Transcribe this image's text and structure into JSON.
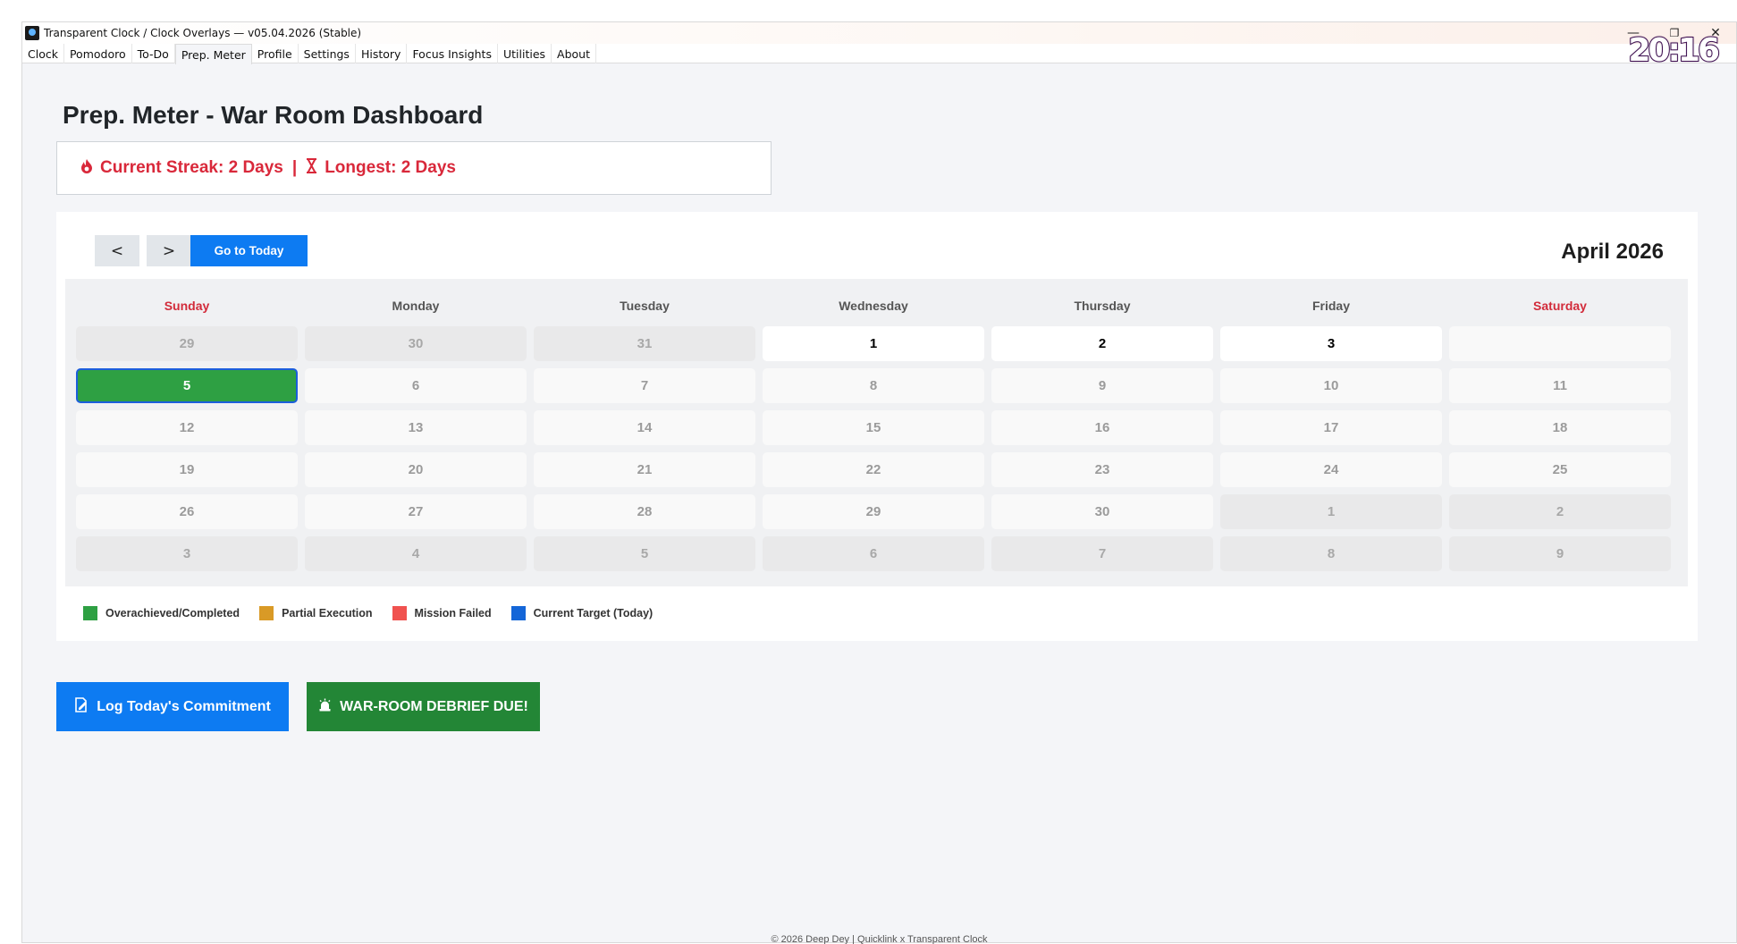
{
  "window": {
    "title": "Transparent Clock / Clock Overlays — v05.04.2026 (Stable)",
    "minimize_symbol": "—",
    "restore_symbol": "❐",
    "close_symbol": "✕",
    "clock_overlay": "20:16"
  },
  "tabs": [
    {
      "label": "Clock",
      "active": false
    },
    {
      "label": "Pomodoro",
      "active": false
    },
    {
      "label": "To-Do",
      "active": false
    },
    {
      "label": "Prep. Meter",
      "active": true
    },
    {
      "label": "Profile",
      "active": false
    },
    {
      "label": "Settings",
      "active": false
    },
    {
      "label": "History",
      "active": false
    },
    {
      "label": "Focus Insights",
      "active": false
    },
    {
      "label": "Utilities",
      "active": false
    },
    {
      "label": "About",
      "active": false
    }
  ],
  "page_title": "Prep. Meter - War Room Dashboard",
  "streak": {
    "current_icon": "fire-icon",
    "current": "Current Streak: 2 Days",
    "separator": "|",
    "longest_icon": "hourglass-icon",
    "longest": "Longest: 2 Days"
  },
  "calendar": {
    "prev_label": "<",
    "next_label": ">",
    "today_label": "Go to Today",
    "month_title": "April 2026",
    "weekdays": [
      "Sunday",
      "Monday",
      "Tuesday",
      "Wednesday",
      "Thursday",
      "Friday",
      "Saturday"
    ],
    "weeks": [
      [
        {
          "d": "29",
          "s": "other"
        },
        {
          "d": "30",
          "s": "other"
        },
        {
          "d": "31",
          "s": "other"
        },
        {
          "d": "1",
          "s": "current-strong"
        },
        {
          "d": "2",
          "s": "current-strong"
        },
        {
          "d": "3",
          "s": "current-strong"
        },
        {
          "d": "",
          "s": "current"
        }
      ],
      [
        {
          "d": "5",
          "s": "completed"
        },
        {
          "d": "6",
          "s": "current"
        },
        {
          "d": "7",
          "s": "current"
        },
        {
          "d": "8",
          "s": "current"
        },
        {
          "d": "9",
          "s": "current"
        },
        {
          "d": "10",
          "s": "current"
        },
        {
          "d": "11",
          "s": "current"
        }
      ],
      [
        {
          "d": "12",
          "s": "current"
        },
        {
          "d": "13",
          "s": "current"
        },
        {
          "d": "14",
          "s": "current"
        },
        {
          "d": "15",
          "s": "current"
        },
        {
          "d": "16",
          "s": "current"
        },
        {
          "d": "17",
          "s": "current"
        },
        {
          "d": "18",
          "s": "current"
        }
      ],
      [
        {
          "d": "19",
          "s": "current"
        },
        {
          "d": "20",
          "s": "current"
        },
        {
          "d": "21",
          "s": "current"
        },
        {
          "d": "22",
          "s": "current"
        },
        {
          "d": "23",
          "s": "current"
        },
        {
          "d": "24",
          "s": "current"
        },
        {
          "d": "25",
          "s": "current"
        }
      ],
      [
        {
          "d": "26",
          "s": "current"
        },
        {
          "d": "27",
          "s": "current"
        },
        {
          "d": "28",
          "s": "current"
        },
        {
          "d": "29",
          "s": "current"
        },
        {
          "d": "30",
          "s": "current"
        },
        {
          "d": "1",
          "s": "other"
        },
        {
          "d": "2",
          "s": "other"
        }
      ],
      [
        {
          "d": "3",
          "s": "other"
        },
        {
          "d": "4",
          "s": "other"
        },
        {
          "d": "5",
          "s": "other"
        },
        {
          "d": "6",
          "s": "other"
        },
        {
          "d": "7",
          "s": "other"
        },
        {
          "d": "8",
          "s": "other"
        },
        {
          "d": "9",
          "s": "other"
        }
      ]
    ]
  },
  "legend": [
    {
      "label": "Overachieved/Completed",
      "color": "#2ea043"
    },
    {
      "label": "Partial Execution",
      "color": "#d99a26"
    },
    {
      "label": "Mission Failed",
      "color": "#f0524f"
    },
    {
      "label": "Current Target (Today)",
      "color": "#1466d8"
    }
  ],
  "actions": {
    "log_icon": "edit-note-icon",
    "log_label": "Log Today's Commitment",
    "log_color": "#0d7bf2",
    "debrief_icon": "alarm-siren-icon",
    "debrief_label": "WAR-ROOM DEBRIEF DUE!",
    "debrief_color": "#238636"
  },
  "footer": "© 2026 Deep Dey | Quicklink x Transparent Clock"
}
